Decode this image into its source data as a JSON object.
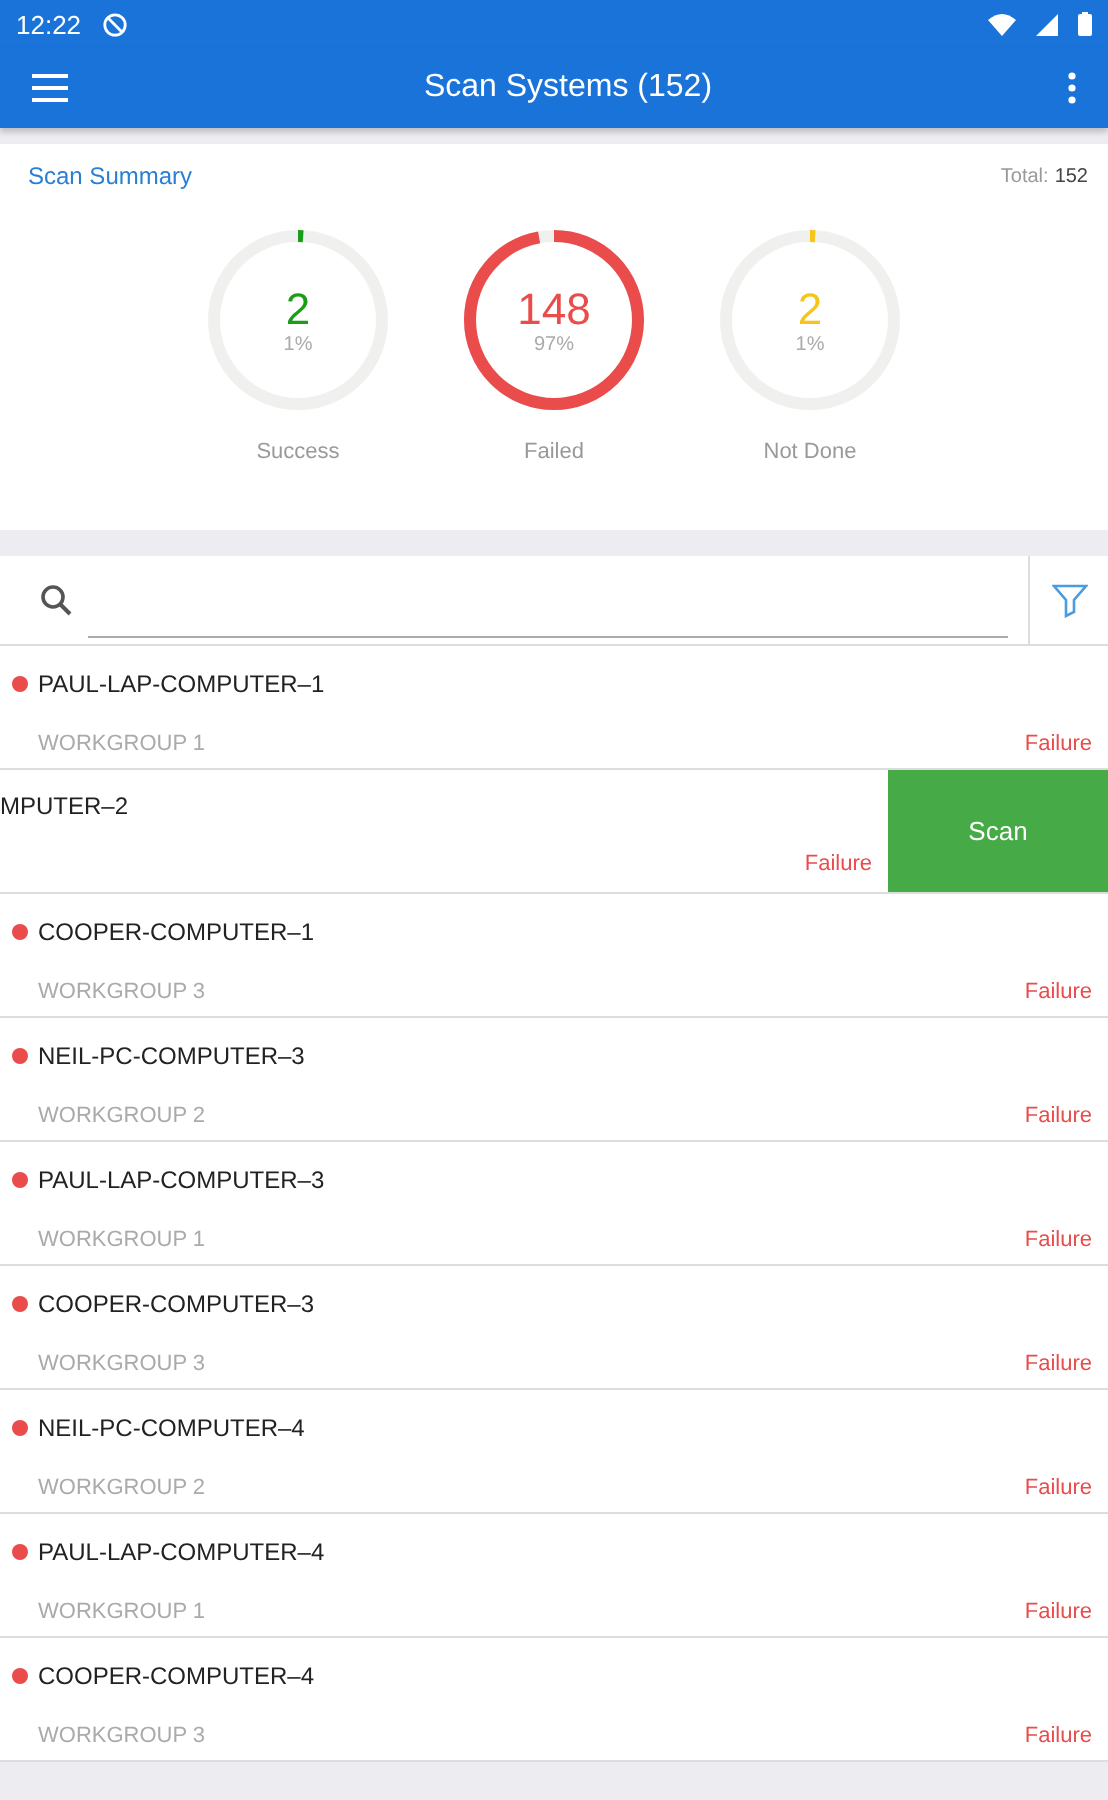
{
  "status_bar": {
    "time": "12:22"
  },
  "app_bar": {
    "title": "Scan Systems (152)"
  },
  "summary": {
    "title": "Scan Summary",
    "total_label": "Total:",
    "total_value": "152",
    "rings": [
      {
        "count": "2",
        "percent": "1%",
        "label": "Success",
        "level": 0.01,
        "color": "#1a9e1a"
      },
      {
        "count": "148",
        "percent": "97%",
        "label": "Failed",
        "level": 0.97,
        "color": "#ea4b4b"
      },
      {
        "count": "2",
        "percent": "1%",
        "label": "Not Done",
        "level": 0.01,
        "color": "#f5c518"
      }
    ]
  },
  "rows": [
    {
      "kind": "normal",
      "name": "PAUL-LAP-COMPUTER–1",
      "group": "WORKGROUP 1",
      "status": "Failure",
      "color": "#ea4b4b"
    },
    {
      "kind": "swiped",
      "name": "MPUTER–2",
      "status": "Failure",
      "action": "Scan"
    },
    {
      "kind": "normal",
      "name": "COOPER-COMPUTER–1",
      "group": "WORKGROUP 3",
      "status": "Failure",
      "color": "#ea4b4b"
    },
    {
      "kind": "normal",
      "name": "NEIL-PC-COMPUTER–3",
      "group": "WORKGROUP 2",
      "status": "Failure",
      "color": "#ea4b4b"
    },
    {
      "kind": "normal",
      "name": "PAUL-LAP-COMPUTER–3",
      "group": "WORKGROUP 1",
      "status": "Failure",
      "color": "#ea4b4b"
    },
    {
      "kind": "normal",
      "name": "COOPER-COMPUTER–3",
      "group": "WORKGROUP 3",
      "status": "Failure",
      "color": "#ea4b4b"
    },
    {
      "kind": "normal",
      "name": "NEIL-PC-COMPUTER–4",
      "group": "WORKGROUP 2",
      "status": "Failure",
      "color": "#ea4b4b"
    },
    {
      "kind": "normal",
      "name": "PAUL-LAP-COMPUTER–4",
      "group": "WORKGROUP 1",
      "status": "Failure",
      "color": "#ea4b4b"
    },
    {
      "kind": "normal",
      "name": "COOPER-COMPUTER–4",
      "group": "WORKGROUP 3",
      "status": "Failure",
      "color": "#ea4b4b"
    }
  ]
}
